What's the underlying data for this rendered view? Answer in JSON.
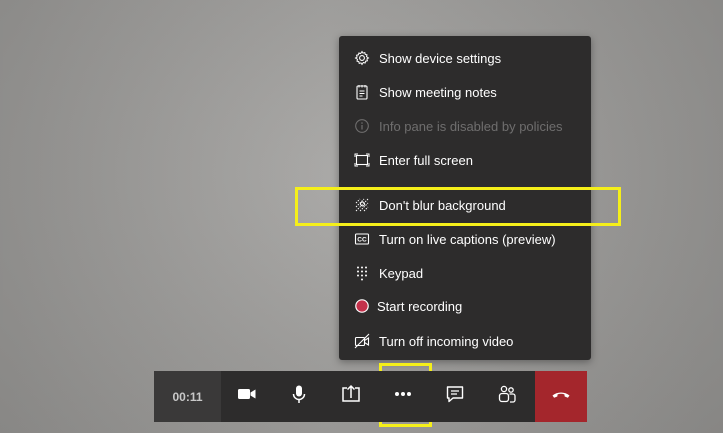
{
  "menu": {
    "items": [
      {
        "label": "Show device settings",
        "icon": "gear-icon",
        "disabled": false
      },
      {
        "label": "Show meeting notes",
        "icon": "notes-icon",
        "disabled": false
      },
      {
        "label": "Info pane is disabled by policies",
        "icon": "info-icon",
        "disabled": true
      },
      {
        "label": "Enter full screen",
        "icon": "fullscreen-icon",
        "disabled": false
      },
      {
        "label": "Don't blur background",
        "icon": "blur-icon",
        "disabled": false
      },
      {
        "label": "Turn on live captions (preview)",
        "icon": "captions-icon",
        "disabled": false
      },
      {
        "label": "Keypad",
        "icon": "keypad-icon",
        "disabled": false
      },
      {
        "label": "Start recording",
        "icon": "record-icon",
        "disabled": false
      },
      {
        "label": "Turn off incoming video",
        "icon": "video-off-icon",
        "disabled": false
      }
    ]
  },
  "toolbar": {
    "timer": "00:11",
    "buttons": [
      "video-camera-icon",
      "microphone-icon",
      "share-screen-icon",
      "more-options-icon",
      "chat-icon",
      "participants-icon",
      "hang-up-icon"
    ]
  },
  "colors": {
    "highlight": "#f5ef1a",
    "menu_bg": "#2d2c2c",
    "hangup": "#a4262c",
    "record": "#c4314b"
  }
}
